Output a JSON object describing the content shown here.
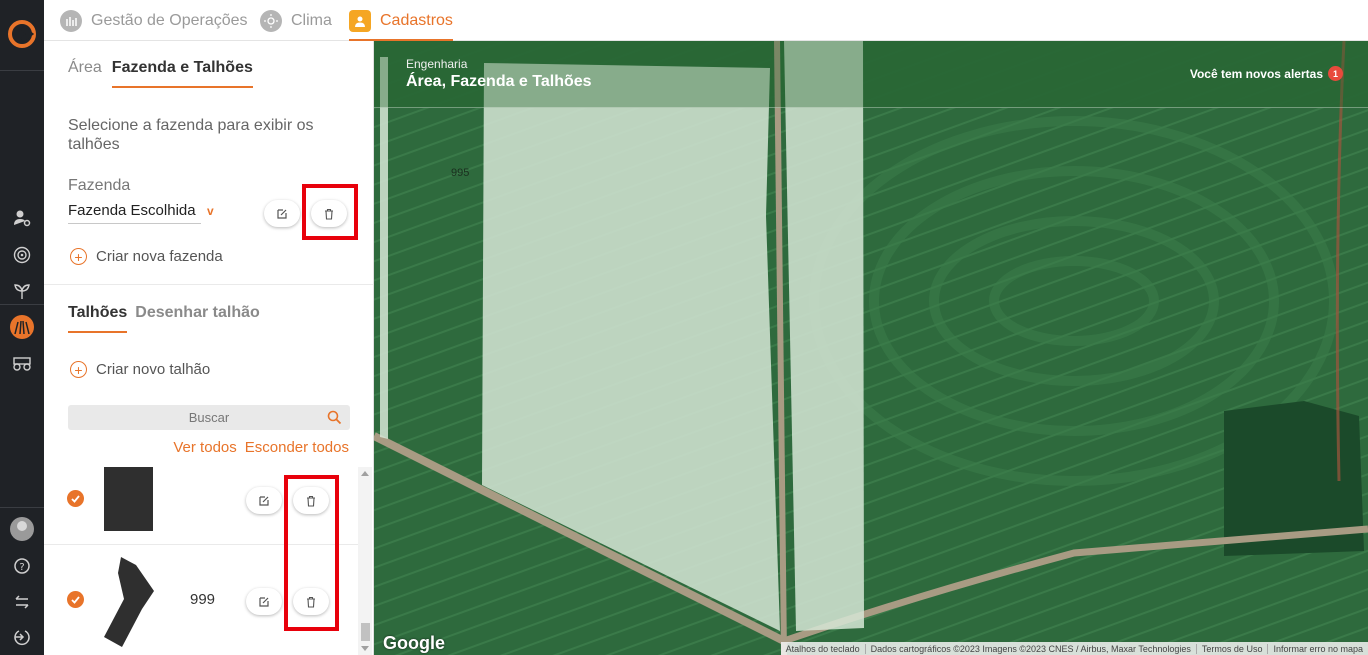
{
  "rail": {
    "icons": [
      "app-logo-icon",
      "users-settings-icon",
      "target-icon",
      "plant-icon",
      "field-icon",
      "tractor-icon",
      "avatar",
      "help-icon",
      "switch-icon",
      "logout-icon"
    ]
  },
  "top_tabs": [
    {
      "label": "Gestão de Operações",
      "icon": "operations-icon",
      "active": false
    },
    {
      "label": "Clima",
      "icon": "sun-icon",
      "active": false
    },
    {
      "label": "Cadastros",
      "icon": "person-icon",
      "active": true
    }
  ],
  "panel": {
    "tabs": {
      "area": "Área",
      "farm": "Fazenda e Talhões"
    },
    "hint": "Selecione a fazenda para exibir os talhões",
    "farm_label": "Fazenda",
    "farm_value": "Fazenda Escolhida",
    "create_farm": "Criar nova fazenda",
    "plot_tabs": {
      "plots": "Talhões",
      "draw": "Desenhar talhão"
    },
    "create_plot": "Criar novo talhão",
    "search_placeholder": "Buscar",
    "show_all": "Ver todos",
    "hide_all": "Esconder todos",
    "rows": [
      {
        "name": "",
        "checked": true,
        "shape": "rectangle"
      },
      {
        "name": "999",
        "checked": true,
        "shape": "bent-polygon"
      }
    ]
  },
  "map": {
    "subtitle": "Engenharia",
    "title": "Área, Fazenda e Talhões",
    "alerts_text": "Você tem novos alertas",
    "alerts_count": "1",
    "plot_label": "995",
    "google": "Google",
    "attribution": [
      "Atalhos do teclado",
      "Dados cartográficos ©2023 Imagens ©2023 CNES / Airbus, Maxar Technologies",
      "Termos de Uso",
      "Informar erro no mapa"
    ]
  },
  "colors": {
    "accent": "#e8742a",
    "highlight": "#e8000b",
    "rail": "#1f2226"
  }
}
